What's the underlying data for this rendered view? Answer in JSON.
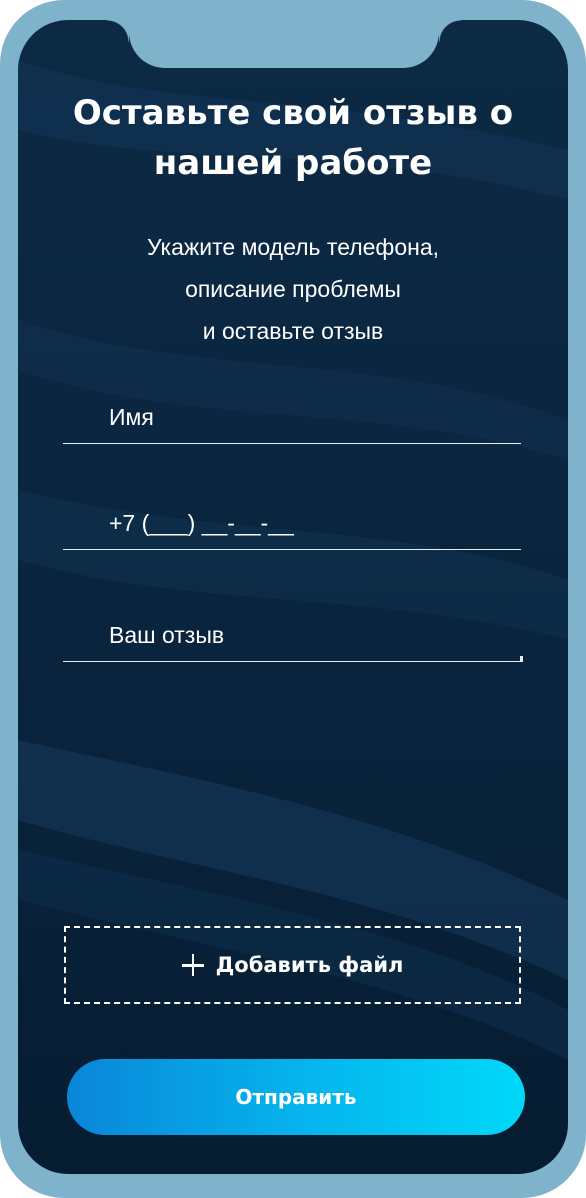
{
  "form": {
    "title_line1": "Оставьте свой отзыв о",
    "title_line2": "нашей работе",
    "subtitle_line1": "Укажите модель телефона,",
    "subtitle_line2": "описание проблемы",
    "subtitle_line3": "и оставьте отзыв",
    "name_placeholder": "Имя",
    "phone_mask": "+7 (___) __-__-__",
    "review_placeholder": "Ваш отзыв",
    "add_file_label": "Добавить файл",
    "submit_label": "Отправить"
  },
  "colors": {
    "frame": "#7fb3cc",
    "background": "#0a2640",
    "text": "#ffffff",
    "button_gradient_start": "#0a86d9",
    "button_gradient_end": "#00d8f8"
  },
  "icons": {
    "add_file": "plus-icon"
  }
}
